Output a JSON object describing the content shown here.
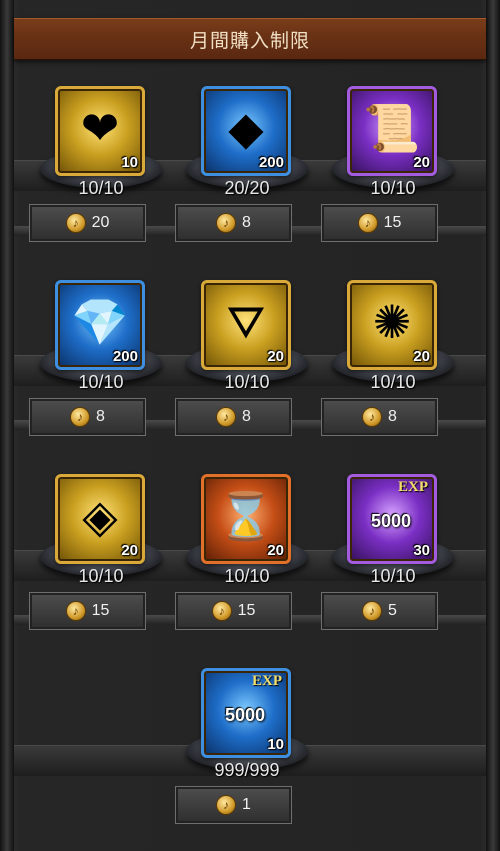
{
  "title": "月間購入制限",
  "items": [
    {
      "icon": "heart-emblem-icon",
      "glyph": "❤",
      "frame": "gold",
      "qty": "10",
      "limit": "10/10",
      "price": "20"
    },
    {
      "icon": "orange-crystal-icon",
      "glyph": "◆",
      "frame": "blue",
      "qty": "200",
      "limit": "20/20",
      "price": "8"
    },
    {
      "icon": "scroll-icon",
      "glyph": "📜",
      "frame": "purple",
      "qty": "20",
      "limit": "10/10",
      "price": "15"
    },
    {
      "icon": "blue-ore-icon",
      "glyph": "💎",
      "frame": "blue",
      "qty": "200",
      "limit": "10/10",
      "price": "8"
    },
    {
      "icon": "crest-icon",
      "glyph": "⛛",
      "frame": "gold",
      "qty": "20",
      "limit": "10/10",
      "price": "8"
    },
    {
      "icon": "gold-medal-icon",
      "glyph": "✺",
      "frame": "gold",
      "qty": "20",
      "limit": "10/10",
      "price": "8"
    },
    {
      "icon": "purple-gem-icon",
      "glyph": "◈",
      "frame": "gold",
      "qty": "20",
      "limit": "10/10",
      "price": "15"
    },
    {
      "icon": "hourglass-hammer-icon",
      "glyph": "⌛",
      "frame": "orange",
      "qty": "20",
      "limit": "10/10",
      "price": "15"
    },
    {
      "icon": "exp-book-icon",
      "glyph": "",
      "frame": "purple",
      "qty": "30",
      "limit": "10/10",
      "price": "5",
      "exp_label": "EXP",
      "exp_value": "5000"
    },
    {
      "icon": "exp-book-icon",
      "glyph": "",
      "frame": "blue",
      "qty": "10",
      "limit": "999/999",
      "price": "1",
      "exp_label": "EXP",
      "exp_value": "5000"
    }
  ]
}
